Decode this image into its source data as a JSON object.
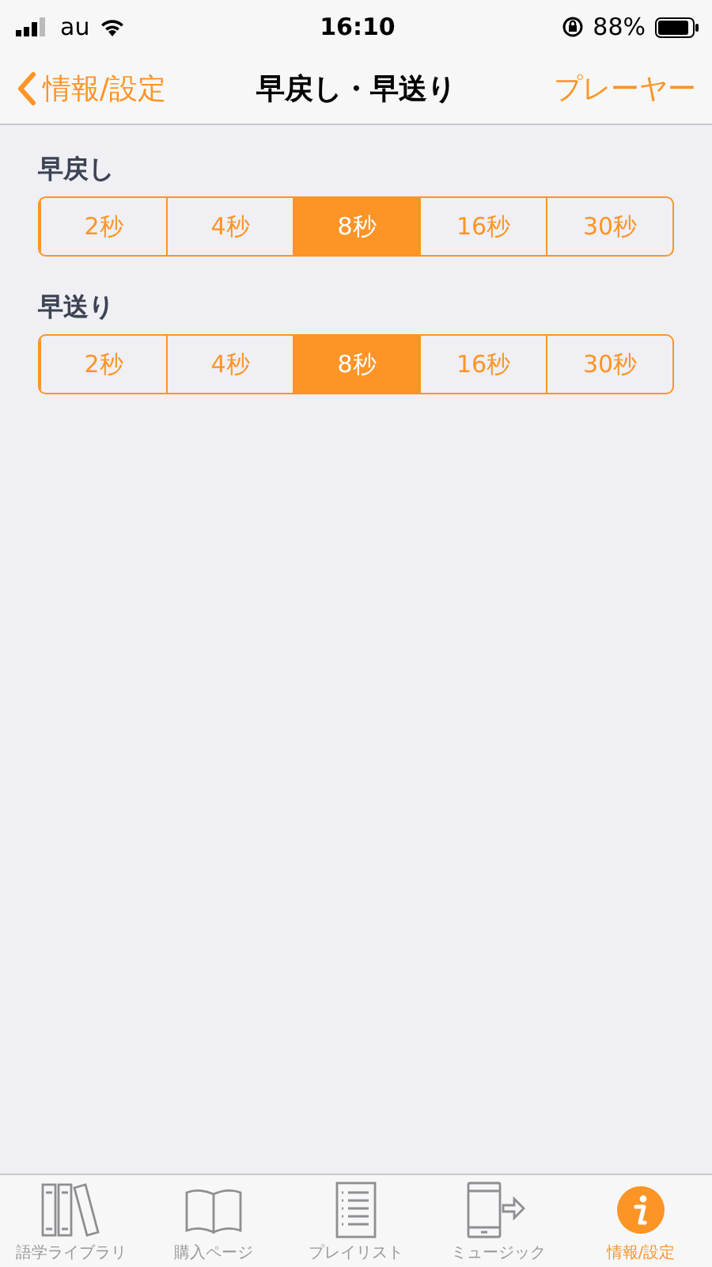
{
  "status_bar": {
    "carrier": "au",
    "time": "16:10",
    "battery": "88%"
  },
  "nav_bar": {
    "back": "情報/設定",
    "title": "早戻し・早送り",
    "action": "プレーヤー"
  },
  "sections": [
    {
      "label": "早戻し",
      "options": [
        {
          "label": "2秒",
          "selected": false
        },
        {
          "label": "4秒",
          "selected": false
        },
        {
          "label": "8秒",
          "selected": true
        },
        {
          "label": "16秒",
          "selected": false
        },
        {
          "label": "30秒",
          "selected": false
        }
      ]
    },
    {
      "label": "早送り",
      "options": [
        {
          "label": "2秒",
          "selected": false
        },
        {
          "label": "4秒",
          "selected": false
        },
        {
          "label": "8秒",
          "selected": true
        },
        {
          "label": "16秒",
          "selected": false
        },
        {
          "label": "30秒",
          "selected": false
        }
      ]
    }
  ],
  "tab_bar": [
    {
      "kind": "library",
      "label": "語学ライブラリ",
      "selected": false
    },
    {
      "kind": "book",
      "label": "購入ページ",
      "selected": false
    },
    {
      "kind": "list",
      "label": "プレイリスト",
      "selected": false
    },
    {
      "kind": "device",
      "label": "ミュージック",
      "selected": false
    },
    {
      "kind": "info",
      "label": "情報/設定",
      "selected": true
    }
  ]
}
